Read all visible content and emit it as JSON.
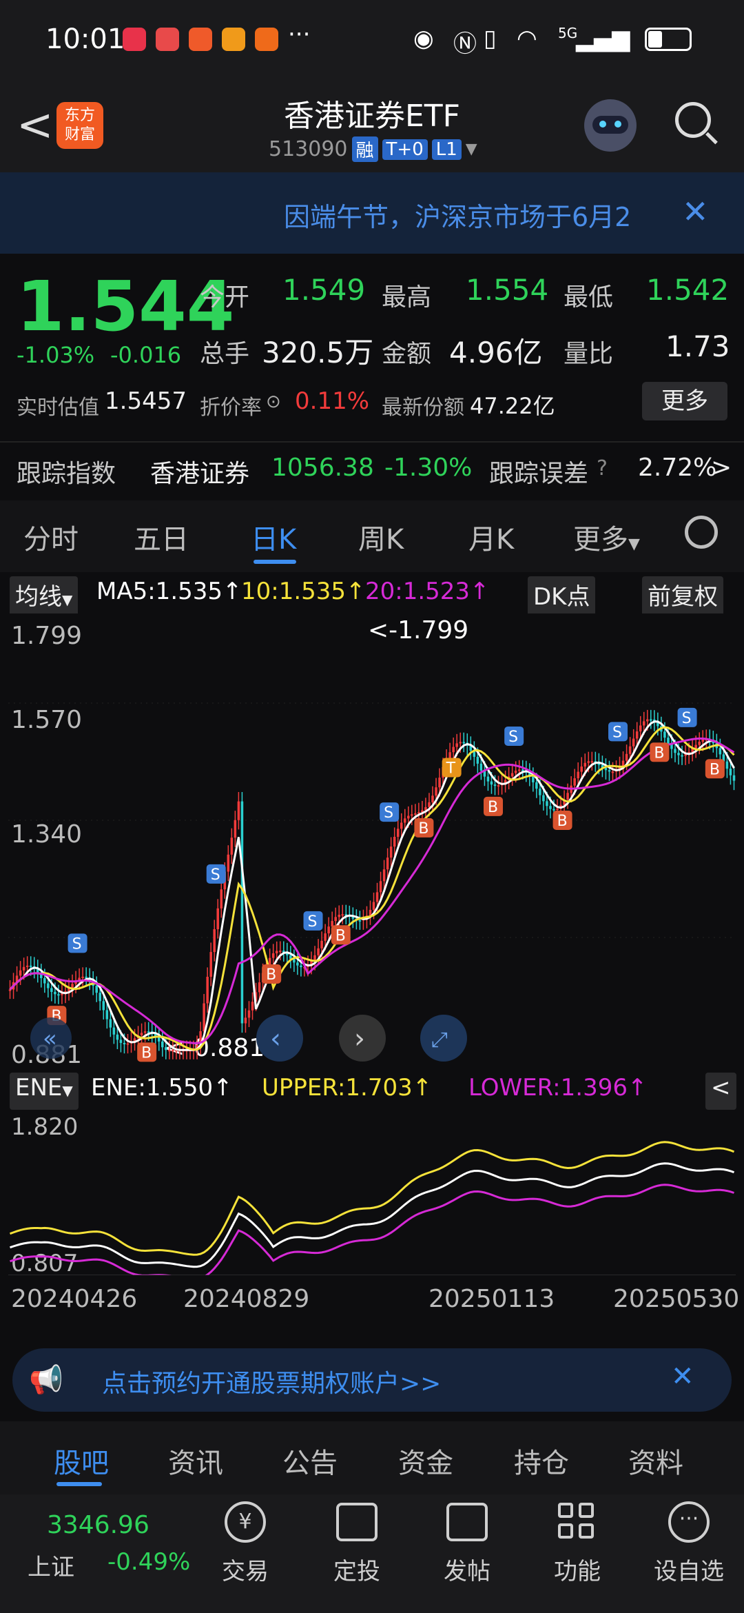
{
  "status_bar": {
    "time": "10:01",
    "more": "···",
    "network": "5G",
    "icons": [
      "eye-icon",
      "nfc-icon",
      "vibrate-icon",
      "wifi-icon",
      "signal-icon",
      "battery-icon"
    ]
  },
  "header": {
    "back": "<",
    "logo_line1": "东方",
    "logo_line2": "财富",
    "title": "香港证券ETF",
    "code": "513090",
    "tags": [
      "融",
      "T+0",
      "L1"
    ]
  },
  "notice": {
    "text": "因端午节，沪深京市场于6月2",
    "close": "✕"
  },
  "quote": {
    "price": "1.544",
    "change_pct": "-1.03%",
    "change_val": "-0.016",
    "open_label": "今开",
    "open": "1.549",
    "high_label": "最高",
    "high": "1.554",
    "low_label": "最低",
    "low": "1.542",
    "vol_label": "总手",
    "vol": "320.5万",
    "amount_label": "金额",
    "amount": "4.96亿",
    "ratio_label": "量比",
    "ratio": "1.73",
    "est_label": "实时估值",
    "est": "1.5457",
    "discount_label": "折价率",
    "discount": "0.11%",
    "share_label": "最新份额",
    "share": "47.22亿",
    "more": "更多",
    "track_label": "跟踪指数",
    "track_name": "香港证券",
    "track_value": "1056.38",
    "track_pct": "-1.30%",
    "error_label": "跟踪误差",
    "error_value": "2.72%",
    "error_arrow": ">"
  },
  "k_tabs": [
    "分时",
    "五日",
    "日K",
    "周K",
    "月K",
    "更多"
  ],
  "ma_bar": {
    "type": "均线",
    "ma5": "MA5:1.535↑",
    "ma10": "10:1.535↑",
    "ma20": "20:1.523↑",
    "dk": "DK点",
    "fq": "前复权"
  },
  "main_chart": {
    "y_labels": [
      "1.799",
      "1.570",
      "1.340",
      "0.881"
    ],
    "max_label": "<-1.799",
    "min_label": "<-0.881"
  },
  "ene_bar": {
    "type": "ENE",
    "ene": "ENE:1.550↑",
    "upper": "UPPER:1.703↑",
    "lower": "LOWER:1.396↑",
    "collapse": "<"
  },
  "ind_chart": {
    "y_labels": [
      "1.820",
      "0.807"
    ]
  },
  "x_labels": [
    "20240426",
    "20240829",
    "20250113",
    "20250530"
  ],
  "chart_data": {
    "type": "line",
    "title": "",
    "x": [
      "20240426",
      "20240829",
      "20250113",
      "20250530"
    ],
    "ylim": [
      0.881,
      1.799
    ],
    "series": [
      {
        "name": "MA5",
        "values": [
          1.02,
          0.9,
          1.46,
          1.535
        ]
      },
      {
        "name": "10",
        "values": [
          1.03,
          0.9,
          1.45,
          1.535
        ]
      },
      {
        "name": "20",
        "values": [
          1.04,
          0.91,
          1.44,
          1.523
        ]
      }
    ],
    "max": 1.799,
    "min": 0.881
  },
  "banner": {
    "text": "点击预约开通股票期权账户>>",
    "close": "✕"
  },
  "bottom_tabs": [
    "股吧",
    "资讯",
    "公告",
    "资金",
    "持仓",
    "资料"
  ],
  "index_ticker": {
    "name": "上证",
    "value": "3346.96",
    "pct": "-0.49%"
  },
  "toolbar": [
    "交易",
    "定投",
    "发帖",
    "功能",
    "设自选"
  ],
  "colors": {
    "up": "#f23b3b",
    "down": "#2fd35a",
    "accent": "#3e8ef0",
    "ma5": "#ffffff",
    "ma10": "#f5e23a",
    "ma20": "#d62ad6"
  }
}
